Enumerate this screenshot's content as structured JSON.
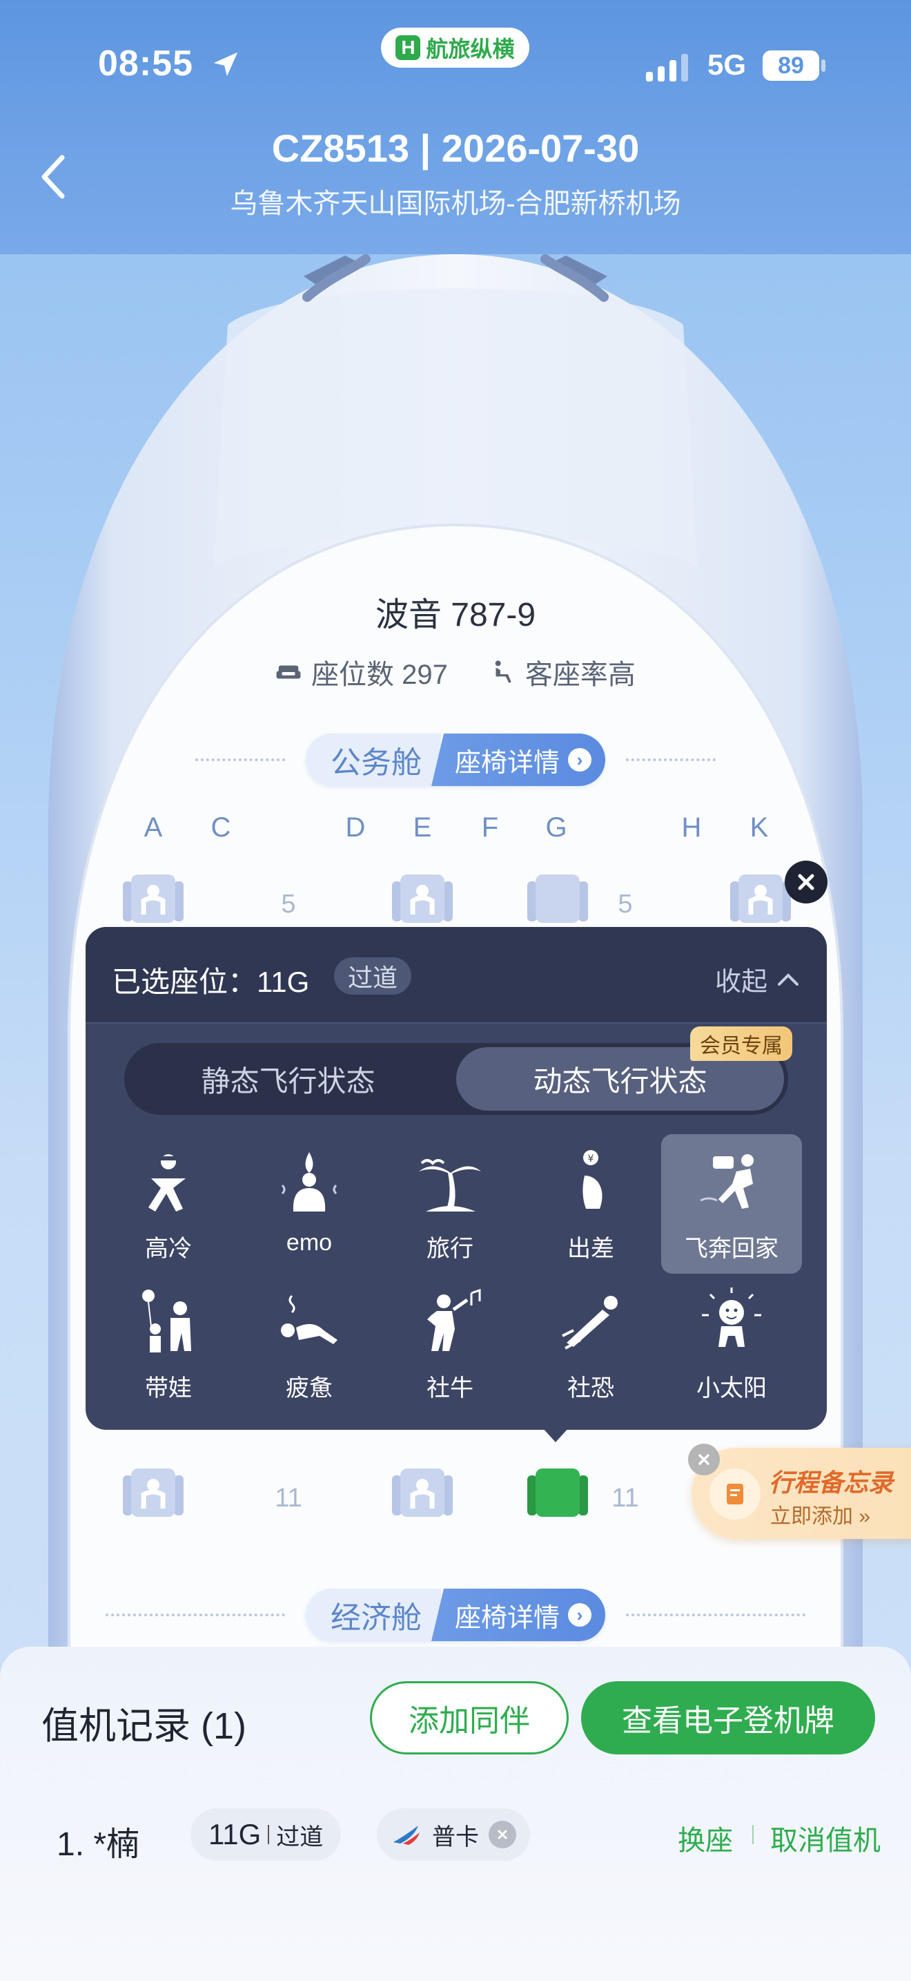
{
  "status_bar": {
    "time": "08:55",
    "app_name": "航旅纵横",
    "app_mark": "H",
    "network": "5G",
    "battery": "89"
  },
  "header": {
    "flight_title": "CZ8513 | 2026-07-30",
    "route": "乌鲁木齐天山国际机场-合肥新桥机场"
  },
  "aircraft": {
    "model": "波音 787-9",
    "seats_text": "座位数 297",
    "load_text": "客座率高"
  },
  "cabins": {
    "business": {
      "name": "公务舱",
      "detail": "座椅详情",
      "arrow": "›"
    },
    "economy": {
      "name": "经济舱",
      "detail": "座椅详情",
      "arrow": "›"
    }
  },
  "columns": [
    "A",
    "C",
    "D",
    "E",
    "F",
    "G",
    "H",
    "K"
  ],
  "rows": {
    "row5": "5",
    "row11": "11"
  },
  "panel": {
    "selected_label": "已选座位：11G",
    "selected_tag": "过道",
    "collapse_label": "收起",
    "tabs": [
      "静态飞行状态",
      "动态飞行状态"
    ],
    "member_badge": "会员专属",
    "moods": [
      "高冷",
      "emo",
      "旅行",
      "出差",
      "飞奔回家",
      "带娃",
      "疲惫",
      "社牛",
      "社恐",
      "小太阳"
    ],
    "active_mood": "飞奔回家"
  },
  "floater": {
    "title": "行程备忘录",
    "subtitle": "立即添加 »"
  },
  "checkin": {
    "title": "值机记录 (1)",
    "add_companion": "添加同伴",
    "view_boarding_pass": "查看电子登机牌",
    "passenger": "1. *楠",
    "seat": "11G",
    "seat_type": "过道",
    "card": "普卡",
    "change_seat": "换座",
    "cancel_checkin": "取消值机"
  },
  "colors": {
    "accent_green": "#2fac4f",
    "header_blue": "#5d95e0",
    "panel_dark": "#3c4564",
    "seat_blue": "#b7c5e6"
  }
}
